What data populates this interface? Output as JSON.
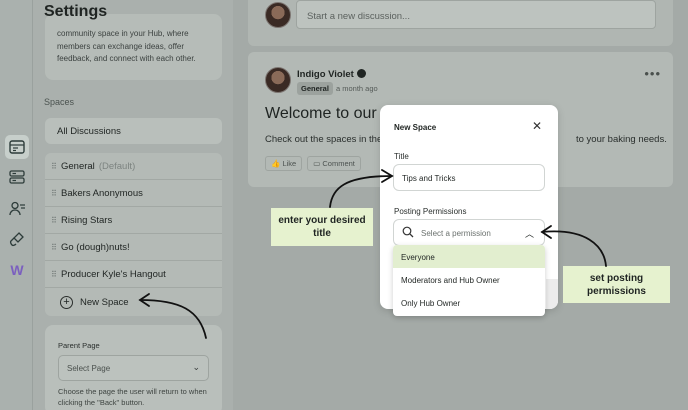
{
  "rail": {
    "icons": [
      "discussions-icon",
      "server-icon",
      "users-icon",
      "paint-icon",
      "logo-icon"
    ],
    "logo_letter": "W"
  },
  "settings": {
    "title": "Settings",
    "description": "community space in your Hub, where members can exchange ideas, offer feedback, and connect with each other.",
    "spaces_label": "Spaces",
    "all_discussions": "All Discussions",
    "spaces": [
      {
        "name": "General",
        "suffix": "(Default)"
      },
      {
        "name": "Bakers Anonymous",
        "suffix": ""
      },
      {
        "name": "Rising Stars",
        "suffix": ""
      },
      {
        "name": "Go (dough)nuts!",
        "suffix": ""
      },
      {
        "name": "Producer Kyle's Hangout",
        "suffix": ""
      }
    ],
    "new_space": "New Space",
    "parent_page_label": "Parent Page",
    "parent_page_placeholder": "Select Page",
    "parent_page_hint": "Choose the page the user will return to when clicking the \"Back\" button."
  },
  "main": {
    "composer_placeholder": "Start a new discussion...",
    "post": {
      "author": "Indigo Violet",
      "tag": "General",
      "when": "a month ago",
      "heading": "Welcome to our c",
      "body_left": "Check out the spaces in the",
      "body_right": "to your baking needs.",
      "like": "Like",
      "comment": "Comment"
    }
  },
  "modal": {
    "title": "New Space",
    "title_label": "Title",
    "title_value": "Tips and Tricks",
    "permissions_label": "Posting Permissions",
    "permissions_placeholder": "Select a permission",
    "options": [
      "Everyone",
      "Moderators and Hub Owner",
      "Only Hub Owner"
    ]
  },
  "callouts": {
    "title_hint": "enter your desired title",
    "permissions_hint": "set posting permissions"
  },
  "colors": {
    "callout": "#e6f2cf",
    "option_highlight": "#e2eecf",
    "logo": "#7b5fbf"
  }
}
